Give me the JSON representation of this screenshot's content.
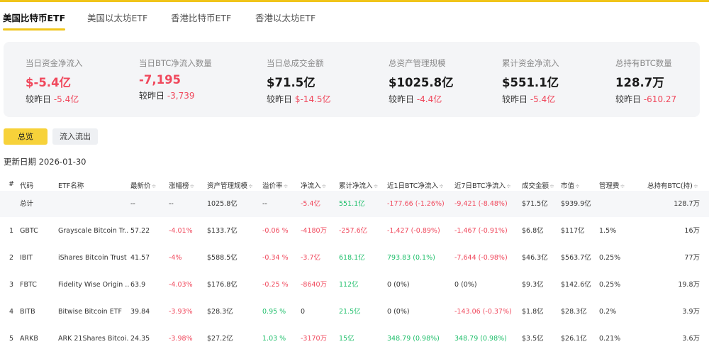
{
  "tabs": [
    {
      "label": "美国比特币ETF"
    },
    {
      "label": "美国以太坊ETF"
    },
    {
      "label": "香港比特币ETF"
    },
    {
      "label": "香港以太坊ETF"
    }
  ],
  "summary": [
    {
      "title": "当日资金净流入",
      "value": "$-5.4亿",
      "value_color": "red",
      "sub_label": "较昨日",
      "sub_value": "-5.4亿"
    },
    {
      "title": "当日BTC净流入数量",
      "value": "-7,195",
      "value_color": "red",
      "sub_label": "较昨日",
      "sub_value": "-3,739"
    },
    {
      "title": "当日总成交金额",
      "value": "$71.5亿",
      "value_color": "dark",
      "sub_label": "较昨日",
      "sub_value": "$-14.5亿"
    },
    {
      "title": "总资产管理规模",
      "value": "$1025.8亿",
      "value_color": "dark",
      "sub_label": "较昨日",
      "sub_value": "-4.4亿"
    },
    {
      "title": "累计资金净流入",
      "value": "$551.1亿",
      "value_color": "dark",
      "sub_label": "较昨日",
      "sub_value": "-5.4亿"
    },
    {
      "title": "总持有BTC数量",
      "value": "128.7万",
      "value_color": "dark",
      "sub_label": "较昨日",
      "sub_value": "-610.27"
    }
  ],
  "buttons": {
    "overview": "总览",
    "flow": "流入流出"
  },
  "update_date": "更新日期 2026-01-30",
  "sort_glyph": "≑",
  "columns": [
    "#",
    "代码",
    "ETF名称",
    "最新价",
    "涨幅榜",
    "资产管理规模",
    "溢价率",
    "净流入",
    "累计净流入",
    "近1日BTC净流入",
    "近7日BTC净流入",
    "成交金额",
    "市值",
    "管理费",
    "总持有BTC(持)"
  ],
  "total_row": {
    "label": "总计",
    "price": "--",
    "change": "--",
    "aum": "1025.8亿",
    "premium": "--",
    "inflow": "-5.4亿",
    "cum_inflow": "551.1亿",
    "btc_1d": "-177.66 (-1.26%)",
    "btc_7d": "-9,421 (-8.48%)",
    "volume": "$71.5亿",
    "market_cap": "$939.9亿",
    "fee": "",
    "holdings": "128.7万"
  },
  "rows": [
    {
      "num": "1",
      "code": "GBTC",
      "name": "Grayscale Bitcoin Tr...",
      "price": "57.22",
      "change": "-4.01%",
      "aum": "$133.7亿",
      "premium": "-0.06 %",
      "inflow": "-4180万",
      "cum_inflow": "-257.6亿",
      "btc_1d": "-1,427 (-0.89%)",
      "btc_7d": "-1,467 (-0.91%)",
      "volume": "$6.8亿",
      "market_cap": "$117亿",
      "fee": "1.5%",
      "holdings": "16万"
    },
    {
      "num": "2",
      "code": "IBIT",
      "name": "iShares Bitcoin Trust",
      "price": "41.57",
      "change": "-4%",
      "aum": "$588.5亿",
      "premium": "-0.34 %",
      "inflow": "-3.7亿",
      "cum_inflow": "618.1亿",
      "btc_1d": "793.83 (0.1%)",
      "btc_7d": "-7,644 (-0.98%)",
      "volume": "$46.3亿",
      "market_cap": "$563.7亿",
      "fee": "0.25%",
      "holdings": "77万"
    },
    {
      "num": "3",
      "code": "FBTC",
      "name": "Fidelity Wise Origin ...",
      "price": "63.9",
      "change": "-4.03%",
      "aum": "$176.8亿",
      "premium": "-0.25 %",
      "inflow": "-8640万",
      "cum_inflow": "112亿",
      "btc_1d": "0 (0%)",
      "btc_7d": "0 (0%)",
      "volume": "$9.3亿",
      "market_cap": "$142.6亿",
      "fee": "0.25%",
      "holdings": "19.8万"
    },
    {
      "num": "4",
      "code": "BITB",
      "name": "Bitwise Bitcoin ETF",
      "price": "39.84",
      "change": "-3.93%",
      "aum": "$28.3亿",
      "premium": "0.95 %",
      "inflow": "0",
      "cum_inflow": "21.5亿",
      "btc_1d": "0 (0%)",
      "btc_7d": "-143.06 (-0.37%)",
      "volume": "$1.8亿",
      "market_cap": "$28.3亿",
      "fee": "0.2%",
      "holdings": "3.9万"
    },
    {
      "num": "5",
      "code": "ARKB",
      "name": "ARK 21Shares Bitcoi...",
      "price": "24.35",
      "change": "-3.98%",
      "aum": "$27.2亿",
      "premium": "1.03 %",
      "inflow": "-3170万",
      "cum_inflow": "15亿",
      "btc_1d": "348.79 (0.98%)",
      "btc_7d": "348.79 (0.98%)",
      "volume": "$3.5亿",
      "market_cap": "$26.1亿",
      "fee": "0.21%",
      "holdings": "3.6万"
    }
  ],
  "colors": {
    "accent": "#f0c419",
    "negative": "#f0485c",
    "positive": "#1fbf6b"
  }
}
